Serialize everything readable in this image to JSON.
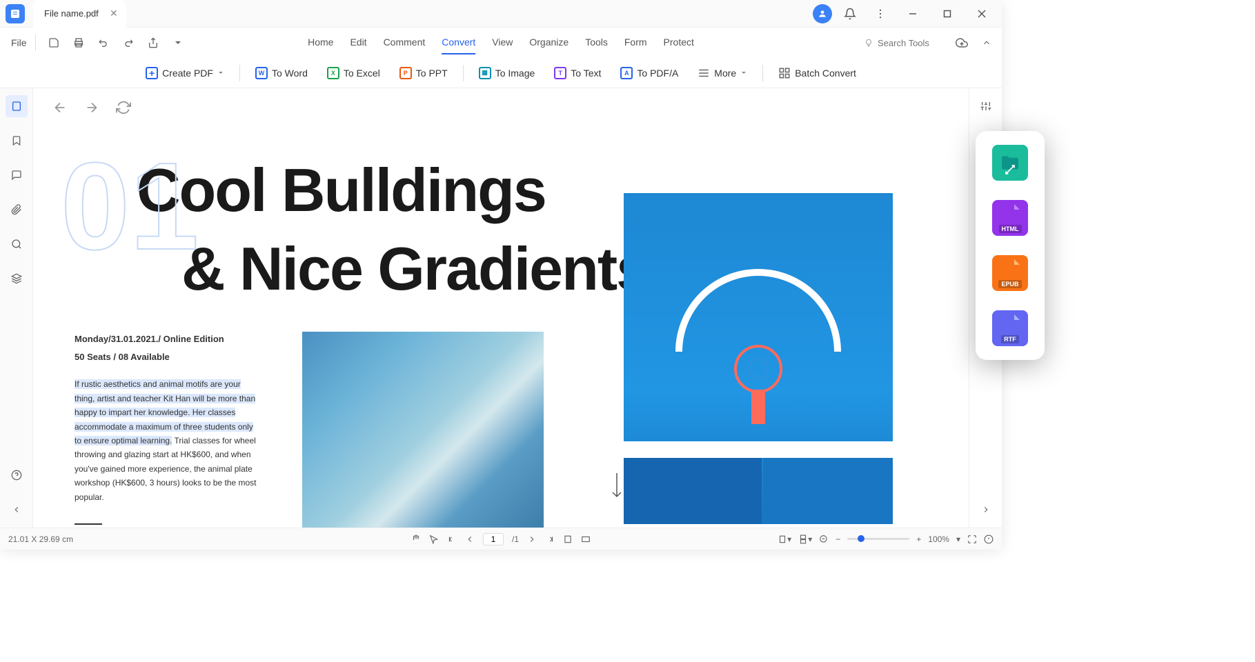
{
  "titlebar": {
    "tab_name": "File name.pdf"
  },
  "menubar": {
    "file": "File",
    "tabs": [
      "Home",
      "Edit",
      "Comment",
      "Convert",
      "View",
      "Organize",
      "Tools",
      "Form",
      "Protect"
    ],
    "active_tab": "Convert",
    "search_placeholder": "Search Tools"
  },
  "toolbar": {
    "create_pdf": "Create PDF",
    "to_word": "To Word",
    "to_excel": "To Excel",
    "to_ppt": "To PPT",
    "to_image": "To Image",
    "to_text": "To Text",
    "to_pdfa": "To PDF/A",
    "more": "More",
    "batch_convert": "Batch Convert"
  },
  "document": {
    "page_number_decoration": "01",
    "heading_line1": "Cool Bulldings",
    "heading_line2": "& Nice Gradients",
    "meta_line1": "Monday/31.01.2021./ Online Edition",
    "meta_line2": "50 Seats / 08 Available",
    "body_highlighted": "If rustic aesthetics and animal motifs are your thing, artist and teacher Kit Han will be more than happy to impart her knowledge. Her classes accommodate a maximum of three students only to ensure optimal learning.",
    "body_rest": " Trial classes for wheel throwing and glazing start at HK$600, and when you've gained more experience, the animal plate workshop (HK$600, 3 hours) looks to be the most popular."
  },
  "float_panel": {
    "items": [
      "folder",
      "HTML",
      "EPUB",
      "RTF"
    ]
  },
  "statusbar": {
    "dimensions": "21.01 X 29.69 cm",
    "page_current": "1",
    "page_total": "/1",
    "zoom": "100%"
  }
}
